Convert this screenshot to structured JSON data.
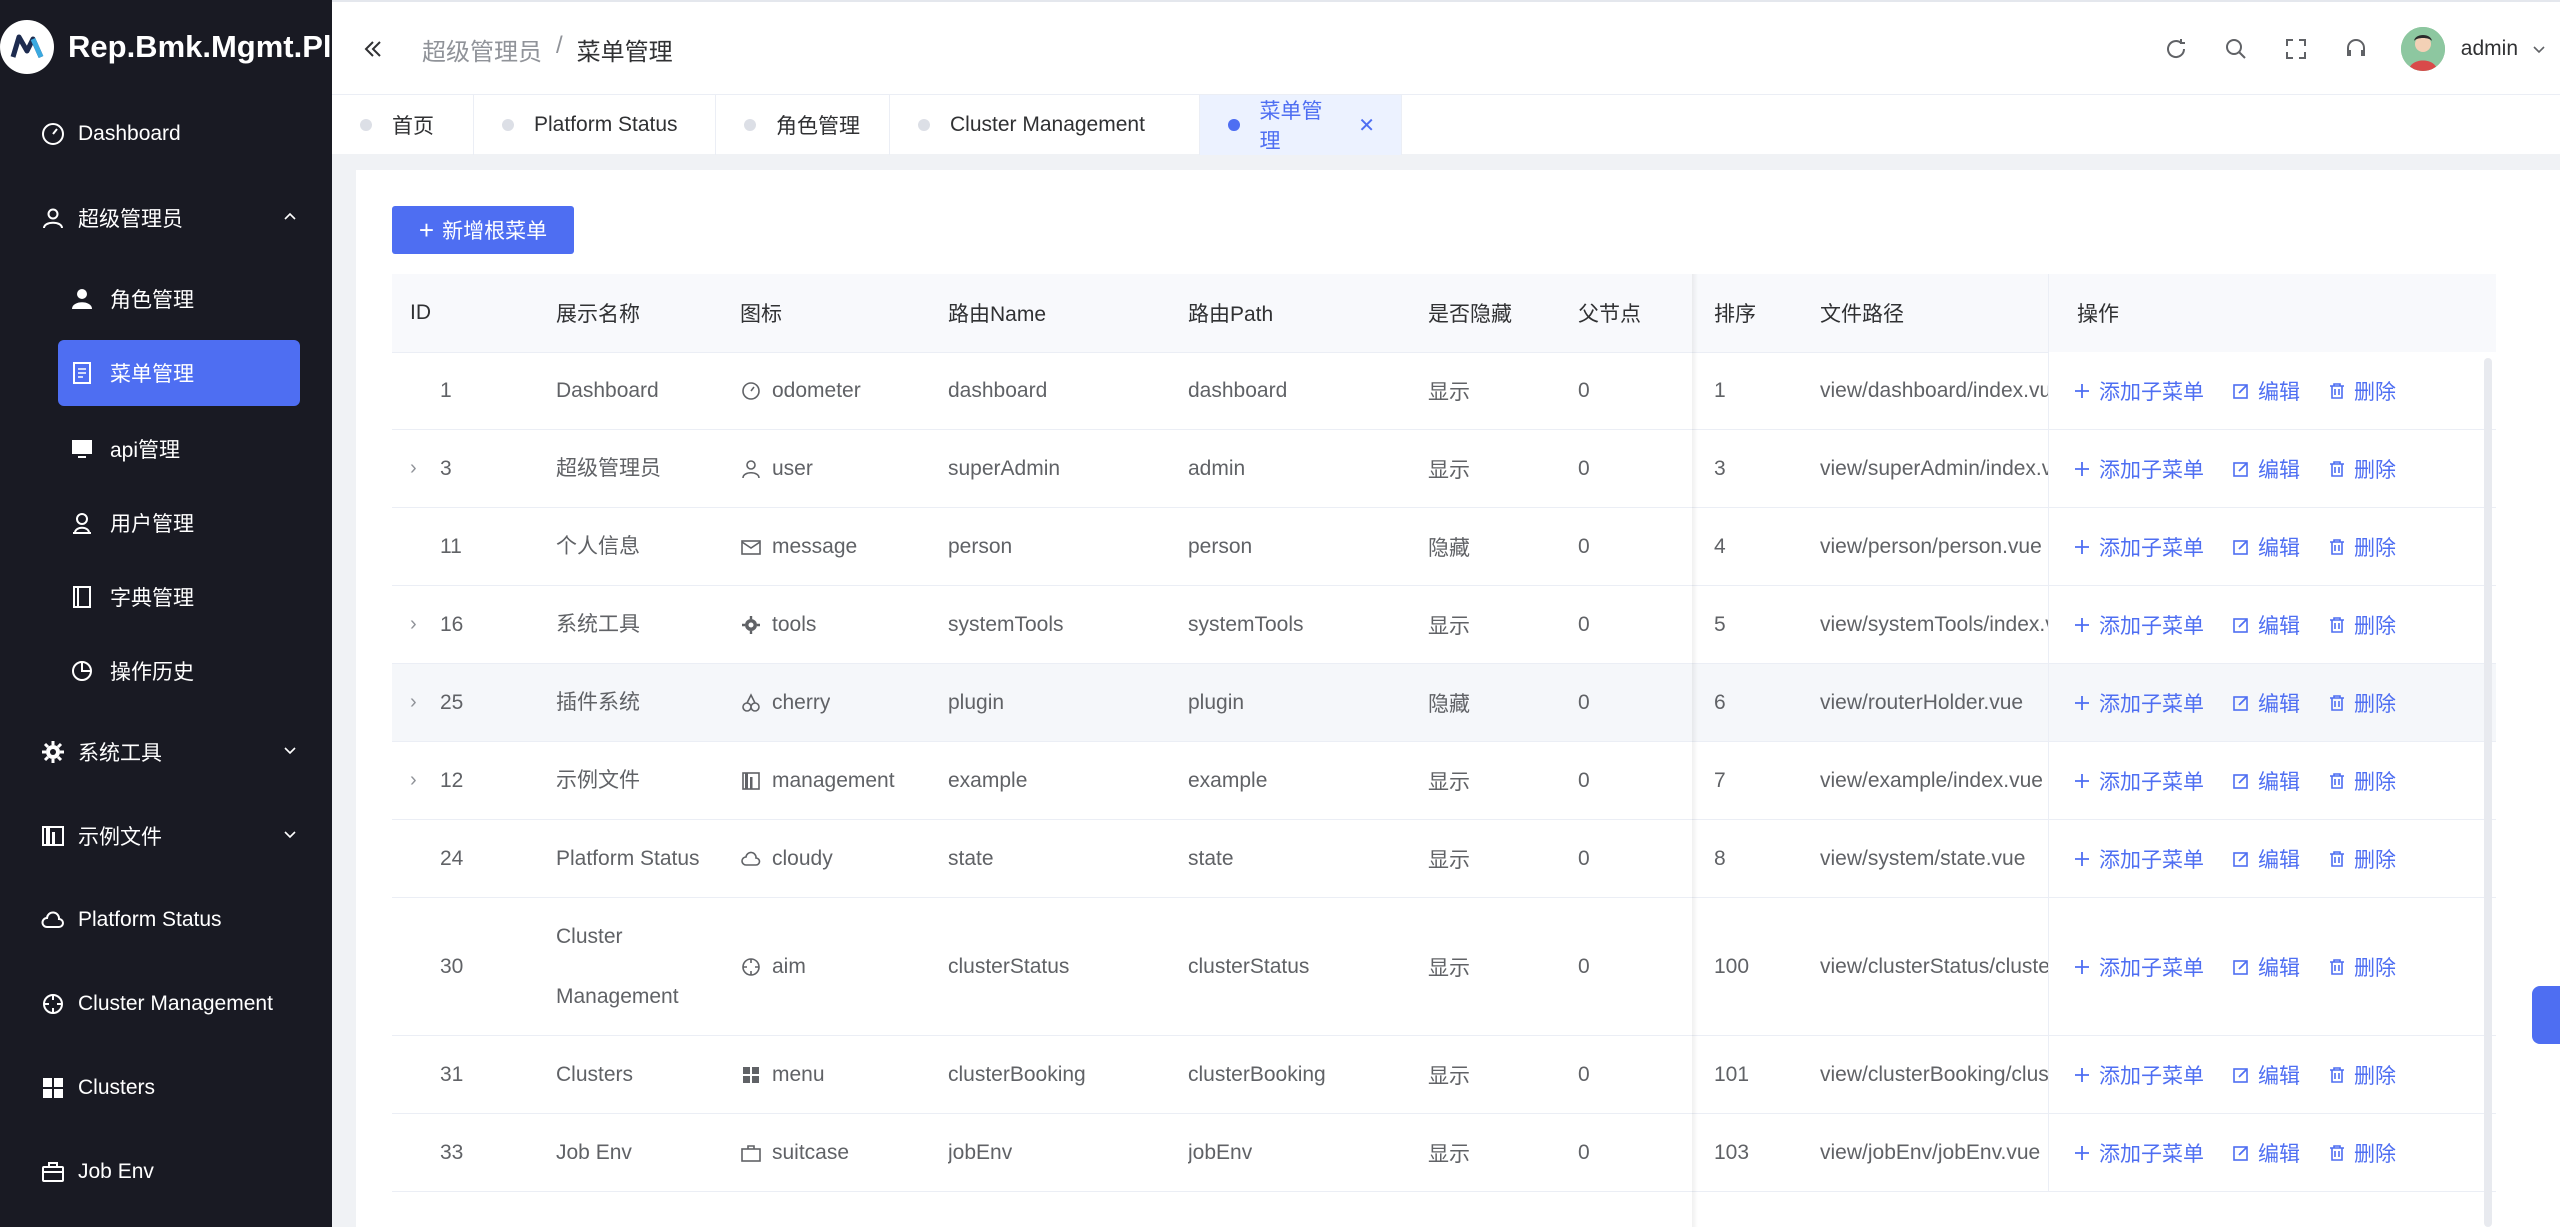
{
  "app": {
    "title": "Rep.Bmk.Mgmt.Pl."
  },
  "sidebar": {
    "items": [
      {
        "label": "Dashboard",
        "icon": "odometer-icon"
      },
      {
        "label": "超级管理员",
        "icon": "user-icon",
        "expanded": true
      },
      {
        "label": "系统工具",
        "icon": "tools-icon"
      },
      {
        "label": "示例文件",
        "icon": "management-icon"
      },
      {
        "label": "Platform Status",
        "icon": "cloudy-icon"
      },
      {
        "label": "Cluster Management",
        "icon": "aim-icon"
      },
      {
        "label": "Clusters",
        "icon": "menu-icon"
      },
      {
        "label": "Job Env",
        "icon": "suitcase-icon"
      }
    ],
    "sub_items": [
      {
        "label": "角色管理",
        "icon": "avatar-icon"
      },
      {
        "label": "菜单管理",
        "icon": "tickets-icon",
        "active": true
      },
      {
        "label": "api管理",
        "icon": "platform-icon"
      },
      {
        "label": "用户管理",
        "icon": "coordinate-icon"
      },
      {
        "label": "字典管理",
        "icon": "notebook-icon"
      },
      {
        "label": "操作历史",
        "icon": "pie-chart-icon"
      }
    ]
  },
  "header": {
    "breadcrumb": [
      "超级管理员",
      "/",
      "菜单管理"
    ],
    "username": "admin"
  },
  "tabs": [
    {
      "label": "首页"
    },
    {
      "label": "Platform Status"
    },
    {
      "label": "角色管理"
    },
    {
      "label": "Cluster Management"
    },
    {
      "label": "菜单管理",
      "active": true
    }
  ],
  "toolbar": {
    "add_root_label": "新增根菜单"
  },
  "table": {
    "columns": [
      "ID",
      "展示名称",
      "图标",
      "路由Name",
      "路由Path",
      "是否隐藏",
      "父节点",
      "排序",
      "文件路径",
      "操作"
    ],
    "rows": [
      {
        "id": "1",
        "name": "Dashboard",
        "icon": "odometer",
        "route_name": "dashboard",
        "route_path": "dashboard",
        "hidden": "显示",
        "parent": "0",
        "sort": "1",
        "file": "view/dashboard/index.vue",
        "expandable": false
      },
      {
        "id": "3",
        "name": "超级管理员",
        "icon": "user",
        "route_name": "superAdmin",
        "route_path": "admin",
        "hidden": "显示",
        "parent": "0",
        "sort": "3",
        "file": "view/superAdmin/index.vue",
        "expandable": true
      },
      {
        "id": "11",
        "name": "个人信息",
        "icon": "message",
        "route_name": "person",
        "route_path": "person",
        "hidden": "隐藏",
        "parent": "0",
        "sort": "4",
        "file": "view/person/person.vue",
        "expandable": false
      },
      {
        "id": "16",
        "name": "系统工具",
        "icon": "tools",
        "route_name": "systemTools",
        "route_path": "systemTools",
        "hidden": "显示",
        "parent": "0",
        "sort": "5",
        "file": "view/systemTools/index.vue",
        "expandable": true
      },
      {
        "id": "25",
        "name": "插件系统",
        "icon": "cherry",
        "route_name": "plugin",
        "route_path": "plugin",
        "hidden": "隐藏",
        "parent": "0",
        "sort": "6",
        "file": "view/routerHolder.vue",
        "expandable": true
      },
      {
        "id": "12",
        "name": "示例文件",
        "icon": "management",
        "route_name": "example",
        "route_path": "example",
        "hidden": "显示",
        "parent": "0",
        "sort": "7",
        "file": "view/example/index.vue",
        "expandable": true
      },
      {
        "id": "24",
        "name": "Platform Status",
        "icon": "cloudy",
        "route_name": "state",
        "route_path": "state",
        "hidden": "显示",
        "parent": "0",
        "sort": "8",
        "file": "view/system/state.vue",
        "expandable": false
      },
      {
        "id": "30",
        "name": "Cluster Management",
        "icon": "aim",
        "route_name": "clusterStatus",
        "route_path": "clusterStatus",
        "hidden": "显示",
        "parent": "0",
        "sort": "100",
        "file": "view/clusterStatus/clusterStatus.vue",
        "expandable": false
      },
      {
        "id": "31",
        "name": "Clusters",
        "icon": "menu",
        "route_name": "clusterBooking",
        "route_path": "clusterBooking",
        "hidden": "显示",
        "parent": "0",
        "sort": "101",
        "file": "view/clusterBooking/clusterBooking.vue",
        "expandable": false
      },
      {
        "id": "33",
        "name": "Job Env",
        "icon": "suitcase",
        "route_name": "jobEnv",
        "route_path": "jobEnv",
        "hidden": "显示",
        "parent": "0",
        "sort": "103",
        "file": "view/jobEnv/jobEnv.vue",
        "expandable": false
      }
    ],
    "actions": {
      "add_child": "添加子菜单",
      "edit": "编辑",
      "delete": "删除"
    }
  },
  "colors": {
    "accent": "#4e6ef2",
    "sidebar_bg": "#191a23"
  }
}
